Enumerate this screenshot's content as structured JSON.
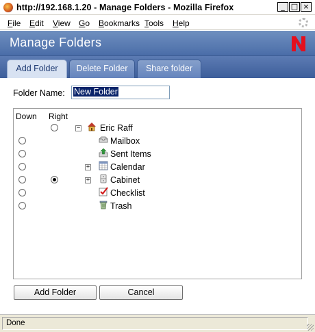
{
  "window": {
    "title": "http://192.168.1.20 - Manage Folders - Mozilla Firefox",
    "controls": [
      "_",
      "□",
      "×"
    ]
  },
  "menu": [
    {
      "label": "File",
      "accel": "F",
      "rest": "ile"
    },
    {
      "label": "Edit",
      "accel": "E",
      "rest": "dit"
    },
    {
      "label": "View",
      "accel": "V",
      "rest": "iew"
    },
    {
      "label": "Go",
      "accel": "G",
      "rest": "o"
    },
    {
      "label": "Bookmarks",
      "accel": "B",
      "rest": "ookmarks"
    },
    {
      "label": "Tools",
      "accel": "T",
      "rest": "ools"
    },
    {
      "label": "Help",
      "accel": "H",
      "rest": "elp"
    }
  ],
  "header": {
    "title": "Manage Folders",
    "logo_letter": "N",
    "logo_color": "#e3101e"
  },
  "tabs": [
    {
      "label": "Add Folder",
      "active": true
    },
    {
      "label": "Delete Folder",
      "active": false
    },
    {
      "label": "Share folder",
      "active": false
    }
  ],
  "form": {
    "folder_name_label": "Folder Name:",
    "folder_name_value": "New Folder"
  },
  "tree": {
    "col_down": "Down",
    "col_right": "Right",
    "root": {
      "label": "Eric Raff",
      "icon": "home-icon",
      "right_radio": true
    },
    "items": [
      {
        "label": "Mailbox",
        "icon": "mailbox-icon",
        "down_checked": false,
        "right_checked": false,
        "expandable": false
      },
      {
        "label": "Sent Items",
        "icon": "sent-items-icon",
        "down_checked": false,
        "right_checked": false,
        "expandable": false
      },
      {
        "label": "Calendar",
        "icon": "calendar-icon",
        "down_checked": false,
        "right_checked": false,
        "expandable": true
      },
      {
        "label": "Cabinet",
        "icon": "cabinet-icon",
        "down_checked": false,
        "right_checked": true,
        "expandable": true
      },
      {
        "label": "Checklist",
        "icon": "checklist-icon",
        "down_checked": false,
        "right_checked": false,
        "expandable": false
      },
      {
        "label": "Trash",
        "icon": "trash-icon",
        "down_checked": false,
        "right_checked": false,
        "expandable": false
      }
    ]
  },
  "buttons": {
    "add_folder": "Add Folder",
    "cancel": "Cancel"
  },
  "status": {
    "text": "Done"
  }
}
